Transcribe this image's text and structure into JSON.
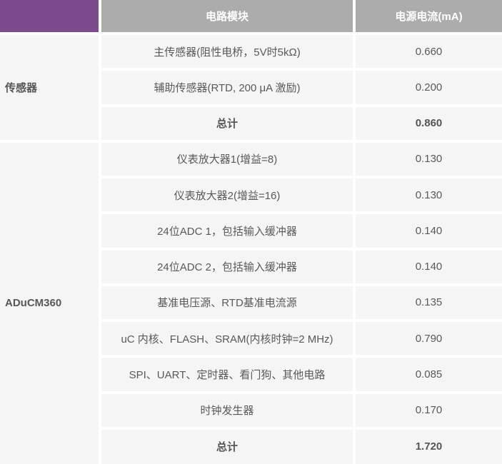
{
  "colors": {
    "header_purple": "#7B4B8D",
    "header_gray": "#ACACAC",
    "cell_bg": "#F5F5F5",
    "gap": "#FFFFFF",
    "body_text": "#595959",
    "header_text": "#FFFFFF"
  },
  "chart_data": {
    "type": "table",
    "columns": [
      "电路模块",
      "电源电流(mA)"
    ],
    "groups": [
      {
        "label": "传感器",
        "rows": [
          {
            "module": "主传感器(阻性电桥，5V时5kΩ)",
            "current": "0.660",
            "bold": false
          },
          {
            "module": "辅助传感器(RTD, 200 μA 激励)",
            "current": "0.200",
            "bold": false
          },
          {
            "module": "总计",
            "current": "0.860",
            "bold": true
          }
        ]
      },
      {
        "label": "ADuCM360",
        "rows": [
          {
            "module": "仪表放大器1(增益=8)",
            "current": "0.130",
            "bold": false
          },
          {
            "module": "仪表放大器2(增益=16)",
            "current": "0.130",
            "bold": false
          },
          {
            "module": "24位ADC 1，包括输入缓冲器",
            "current": "0.140",
            "bold": false
          },
          {
            "module": "24位ADC 2，包括输入缓冲器",
            "current": "0.140",
            "bold": false
          },
          {
            "module": "基准电压源、RTD基准电流源",
            "current": "0.135",
            "bold": false
          },
          {
            "module": "uC 内核、FLASH、SRAM(内核时钟=2 MHz)",
            "current": "0.790",
            "bold": false
          },
          {
            "module": "SPI、UART、定时器、看门狗、其他电路",
            "current": "0.085",
            "bold": false
          },
          {
            "module": "时钟发生器",
            "current": "0.170",
            "bold": false
          },
          {
            "module": "总计",
            "current": "1.720",
            "bold": true
          }
        ]
      }
    ]
  }
}
